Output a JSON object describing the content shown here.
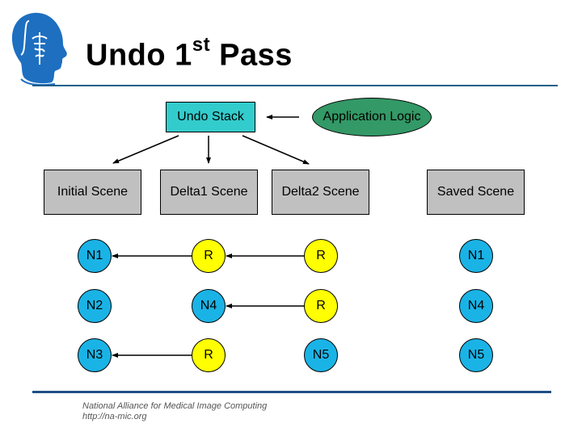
{
  "title": {
    "main": "Undo 1",
    "superscript": "st",
    "rest": " Pass"
  },
  "logo": {
    "icon": "head-caduceus-logo-icon",
    "color": "#1e6fc0"
  },
  "diagram": {
    "undo_stack": {
      "label": "Undo Stack",
      "color": "#33cccc"
    },
    "app_logic": {
      "label": "Application Logic",
      "color": "#339966"
    },
    "scenes": [
      {
        "label": "Initial Scene",
        "color": "#c0c0c0"
      },
      {
        "label": "Delta1 Scene",
        "color": "#c0c0c0"
      },
      {
        "label": "Delta2 Scene",
        "color": "#c0c0c0"
      },
      {
        "label": "Saved Scene",
        "color": "#c0c0c0"
      }
    ],
    "node_colors": {
      "node": "#1ab3e6",
      "reference": "#ffff00"
    },
    "rows": [
      {
        "cells": [
          {
            "label": "N1",
            "type": "node"
          },
          {
            "label": "R",
            "type": "reference"
          },
          {
            "label": "R",
            "type": "reference"
          },
          {
            "label": "N1",
            "type": "node"
          }
        ],
        "arrows": [
          {
            "from": 1,
            "to": 0
          },
          {
            "from": 2,
            "to": 1
          }
        ]
      },
      {
        "cells": [
          {
            "label": "N2",
            "type": "node"
          },
          {
            "label": "N4",
            "type": "node"
          },
          {
            "label": "R",
            "type": "reference"
          },
          {
            "label": "N4",
            "type": "node"
          }
        ],
        "arrows": [
          {
            "from": 2,
            "to": 1
          }
        ]
      },
      {
        "cells": [
          {
            "label": "N3",
            "type": "node"
          },
          {
            "label": "R",
            "type": "reference"
          },
          {
            "label": "N5",
            "type": "node"
          },
          {
            "label": "N5",
            "type": "node"
          }
        ],
        "arrows": [
          {
            "from": 1,
            "to": 0
          }
        ]
      }
    ]
  },
  "footer": {
    "line1": "National Alliance for Medical Image Computing",
    "line2": "http://na-mic.org"
  },
  "accent_color": "#1f5f8b"
}
